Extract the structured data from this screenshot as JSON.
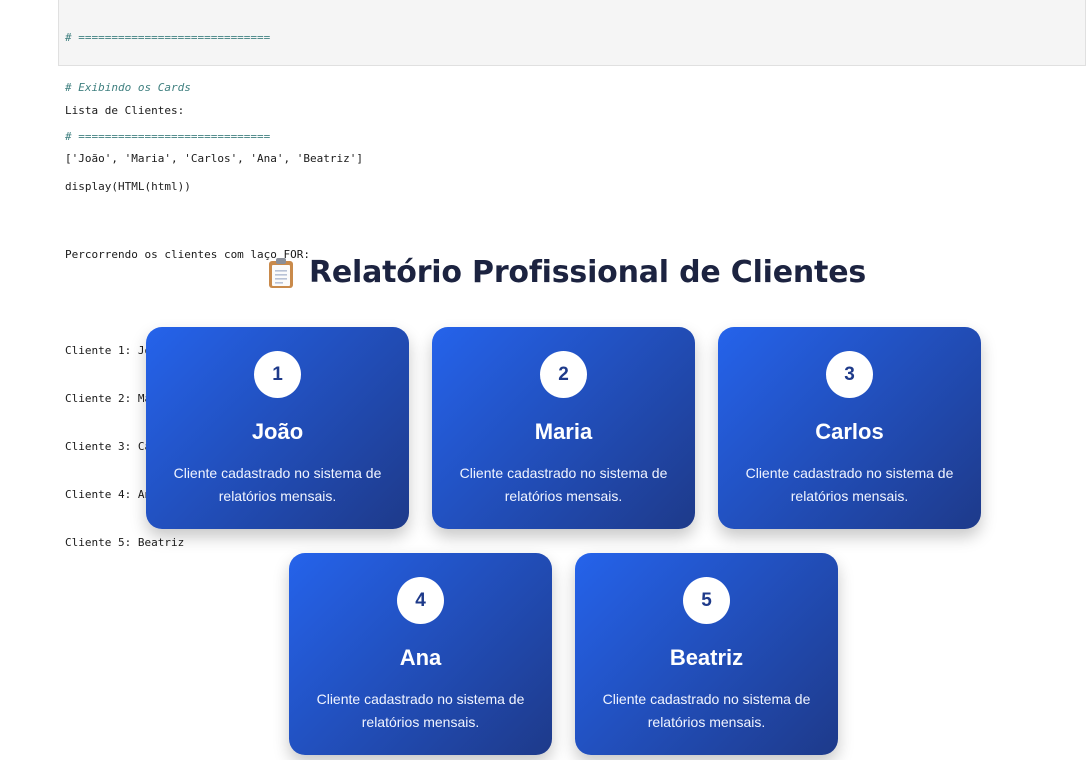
{
  "code": {
    "lines": [
      "# =============================",
      "# Exibindo os Cards",
      "# =============================",
      "display(HTML(html))"
    ]
  },
  "output": {
    "lines": [
      "Lista de Clientes:",
      "['João', 'Maria', 'Carlos', 'Ana', 'Beatriz']",
      "",
      "Percorrendo os clientes com laço FOR:",
      "",
      "Cliente 1: João",
      "Cliente 2: Maria",
      "Cliente 3: Carlos",
      "Cliente 4: Ana",
      "Cliente 5: Beatriz"
    ]
  },
  "report": {
    "title": "Relatório Profissional de Clientes",
    "icon": "clipboard-icon",
    "cards": [
      {
        "number": "1",
        "name": "João",
        "description": "Cliente cadastrado no sistema de relatórios mensais."
      },
      {
        "number": "2",
        "name": "Maria",
        "description": "Cliente cadastrado no sistema de relatórios mensais."
      },
      {
        "number": "3",
        "name": "Carlos",
        "description": "Cliente cadastrado no sistema de relatórios mensais."
      },
      {
        "number": "4",
        "name": "Ana",
        "description": "Cliente cadastrado no sistema de relatórios mensais."
      },
      {
        "number": "5",
        "name": "Beatriz",
        "description": "Cliente cadastrado no sistema de relatórios mensais."
      }
    ]
  },
  "colors": {
    "card_gradient_start": "#2563eb",
    "card_gradient_end": "#1e3a8a",
    "title": "#1c2340"
  }
}
